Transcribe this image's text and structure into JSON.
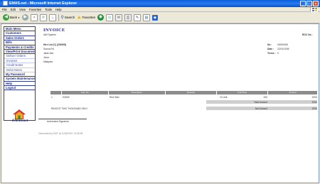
{
  "window": {
    "title": "EMAS.net - Microsoft Internet Explorer"
  },
  "menubar": [
    "File",
    "Edit",
    "View",
    "Favorites",
    "Tools",
    "Help"
  ],
  "toolbar": {
    "back": "Back",
    "search": "Search",
    "favorites": "Favorites"
  },
  "sidebar": {
    "items": [
      {
        "label": "Main Menu",
        "sub": false
      },
      {
        "label": "Customers",
        "sub": false
      },
      {
        "label": "Sales Orders",
        "sub": false
      },
      {
        "label": "Bills",
        "sub": false
      },
      {
        "label": "Payments & Credits",
        "sub": false
      },
      {
        "label": "View/Print Documents",
        "sub": false
      },
      {
        "label": "Deliver Orders",
        "sub": true
      },
      {
        "label": "Invoices",
        "sub": true
      },
      {
        "label": "Credit Notes",
        "sub": true
      },
      {
        "label": "Debit Notes",
        "sub": true
      },
      {
        "label": "My Password",
        "sub": false
      },
      {
        "label": "System Maintenance",
        "sub": false
      },
      {
        "label": "Help",
        "sub": false
      },
      {
        "label": "Logout",
        "sub": false
      }
    ],
    "logo_text": "EMAS.net"
  },
  "invoice": {
    "heading": "INVOICE",
    "system": "IAM System",
    "roc_label": "ROC No :",
    "customer": {
      "name": "Hire Ltd (C) (200008)",
      "addr1": "Sauna Rd",
      "addr2": "Jalan Alor",
      "addr3": "Johor",
      "addr4": "Malaysia"
    },
    "no_label": "No :",
    "no_value": "00000065",
    "date_label": "Date :",
    "date_value": "22/01/2005",
    "terms_label": "Terms :",
    "terms_value": "0",
    "columns": [
      "Item No",
      "Description",
      "Quantity",
      "Unit Price",
      "Amount"
    ],
    "row": {
      "no": "1",
      "item": "H2500",
      "desc": "Red Skirt",
      "qty": "10 Unit",
      "price": "200",
      "amount": "2000"
    },
    "total_label": "Total Amount",
    "total_value": "2000",
    "words": "RINGGIT TWO THOUSAND ONLY",
    "net_label": "Net Amount",
    "net_value": "2000",
    "signature": "Authorised Signature",
    "generated": "Generated by EMT at 11/30/2007 12:55:55"
  }
}
